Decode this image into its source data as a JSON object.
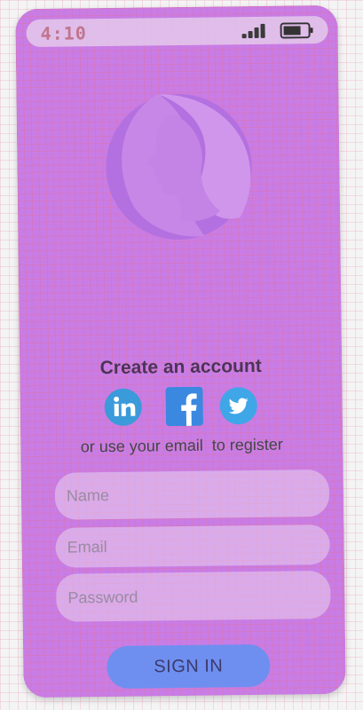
{
  "status_bar": {
    "time": "4:10"
  },
  "title": "Create an account",
  "social": [
    {
      "name": "LinkedIn",
      "icon": "linkedin-icon",
      "color": "#3b9ad9"
    },
    {
      "name": "Facebook",
      "icon": "facebook-icon",
      "color": "#3b88e0"
    },
    {
      "name": "Twitter",
      "icon": "twitter-icon",
      "color": "#3fa6e8"
    }
  ],
  "subtitle": "or use your email  to register",
  "form": {
    "name_placeholder": "Name",
    "email_placeholder": "Email",
    "password_placeholder": "Password",
    "submit_label": "SIGN IN"
  },
  "colors": {
    "phone_background": "#c87de6",
    "logo_fill": "#b06fe0",
    "button": "#6f8ff0",
    "grid_line": "#e26ea0"
  }
}
